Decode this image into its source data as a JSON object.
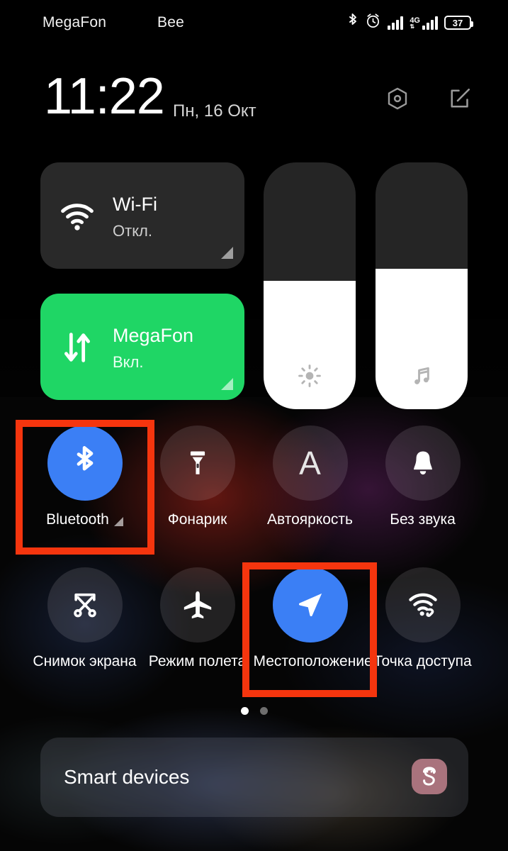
{
  "status_bar": {
    "carrier_1": "MegaFon",
    "carrier_2": "Bee",
    "bluetooth_icon": "bluetooth-icon",
    "alarm_icon": "alarm-clock-icon",
    "sim1_signal_icon": "signal-bars-icon",
    "network_type": "4G",
    "data_arrows": "⇅",
    "sim2_signal_icon": "signal-bars-icon",
    "battery_percent": "37"
  },
  "header": {
    "time": "11:22",
    "date": "Пн, 16 Окт",
    "settings_icon": "settings-gear-icon",
    "edit_icon": "edit-pencil-icon"
  },
  "big_tiles": [
    {
      "id": "wifi",
      "title": "Wi-Fi",
      "status": "Откл.",
      "icon": "wifi-icon",
      "state": "off",
      "bg": "#292929"
    },
    {
      "id": "mobile-data",
      "title": "MegaFon",
      "status": "Вкл.",
      "icon": "data-transfer-arrows-icon",
      "state": "on",
      "bg": "#1fd665"
    }
  ],
  "sliders": [
    {
      "id": "brightness",
      "icon": "brightness-sun-icon",
      "value": 52
    },
    {
      "id": "volume",
      "icon": "music-note-icon",
      "value": 57
    }
  ],
  "toggles": [
    {
      "id": "bluetooth",
      "label": "Bluetooth",
      "icon": "bluetooth-icon",
      "state": "on",
      "expandable": true,
      "highlighted": true
    },
    {
      "id": "flashlight",
      "label": "Фонарик",
      "icon": "flashlight-icon",
      "state": "off",
      "expandable": false,
      "highlighted": false
    },
    {
      "id": "auto-brightness",
      "label": "Автояркость",
      "icon": "auto-brightness-a-icon",
      "state": "off",
      "expandable": false,
      "highlighted": false
    },
    {
      "id": "silent",
      "label": "Без звука",
      "icon": "bell-icon",
      "state": "off",
      "expandable": false,
      "highlighted": false
    },
    {
      "id": "screenshot",
      "label": "Снимок экрана",
      "icon": "screenshot-scissors-icon",
      "state": "off",
      "expandable": false,
      "highlighted": false
    },
    {
      "id": "airplane-mode",
      "label": "Режим полета",
      "icon": "airplane-icon",
      "state": "off",
      "expandable": false,
      "highlighted": false
    },
    {
      "id": "location",
      "label": "Местоположение",
      "icon": "location-arrow-icon",
      "state": "on",
      "expandable": false,
      "highlighted": true
    },
    {
      "id": "hotspot",
      "label": "Точка доступа",
      "icon": "hotspot-icon",
      "state": "off",
      "expandable": false,
      "highlighted": false
    }
  ],
  "pagination": {
    "total": 2,
    "active_index": 0
  },
  "smart_devices": {
    "title": "Smart devices",
    "icon": "smart-devices-app-icon"
  },
  "colors": {
    "accent_on": "#3b7ff5",
    "tile_on_green": "#1fd665",
    "tile_off": "#292929",
    "annotation_red": "#f5350e",
    "smart_icon_bg": "#a9737d"
  }
}
